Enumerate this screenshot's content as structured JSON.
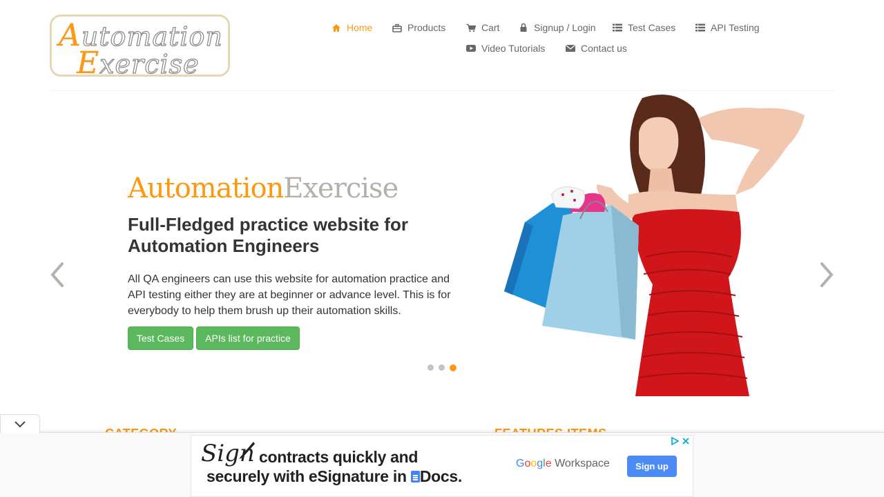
{
  "logo": {
    "line1_cap": "A",
    "line1_rest": "utomation",
    "line2_cap": "E",
    "line2_rest": "xercise"
  },
  "nav": {
    "items": [
      {
        "label": "Home",
        "icon": "home-icon"
      },
      {
        "label": "Products",
        "icon": "briefcase-icon"
      },
      {
        "label": "Cart",
        "icon": "cart-icon"
      },
      {
        "label": "Signup / Login",
        "icon": "lock-icon"
      },
      {
        "label": "Test Cases",
        "icon": "list-icon"
      },
      {
        "label": "API Testing",
        "icon": "list-icon"
      },
      {
        "label": "Video Tutorials",
        "icon": "youtube-icon"
      },
      {
        "label": "Contact us",
        "icon": "envelope-icon"
      }
    ],
    "active": "Home"
  },
  "slider": {
    "brand_a": "Automation",
    "brand_b": "Exercise",
    "headline": "Full-Fledged practice website for Automation Engineers",
    "description": "All QA engineers can use this website for automation practice and API testing either they are at beginner or advance level. This is for everybody to help them brush up their automation skills.",
    "buttons": [
      "Test Cases",
      "APIs list for practice"
    ],
    "dots": 3,
    "active_dot": 3
  },
  "sections": {
    "left": "CATEGORY",
    "right": "FEATURES ITEMS"
  },
  "ad": {
    "sign_word": "Sign",
    "line1": "contracts quickly and",
    "line2": "securely with eSignature in",
    "docs": "Docs.",
    "brand": "Google Workspace",
    "cta": "Sign up"
  },
  "colors": {
    "accent": "#fe980f",
    "button": "#5cb85c",
    "dress": "#d0161b",
    "ad_button": "#4c8bf5"
  }
}
